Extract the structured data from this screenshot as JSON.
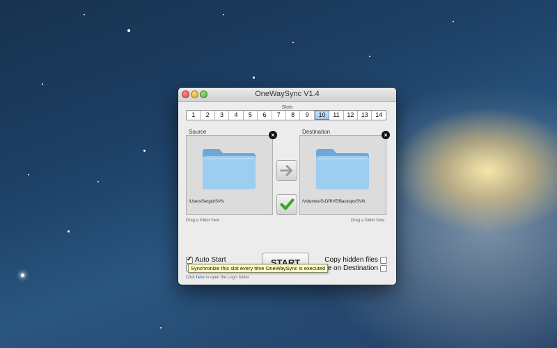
{
  "window": {
    "title": "OneWaySync V1.4"
  },
  "slots": {
    "label": "Slots",
    "items": [
      "1",
      "2",
      "3",
      "4",
      "5",
      "6",
      "7",
      "8",
      "9",
      "10",
      "11",
      "12",
      "13",
      "14"
    ],
    "active": "10"
  },
  "source": {
    "label": "Source",
    "path": "/Users/Sergio/SVN",
    "drag_hint": "Drag a folder here"
  },
  "destination": {
    "label": "Destination",
    "path": "/Volumes/G-DRIVE/Backups/SVN",
    "drag_hint": "Drag a folder here"
  },
  "options": {
    "auto_start": {
      "label": "Auto Start",
      "checked": true
    },
    "copy_hidden": {
      "label": "Copy hidden files",
      "checked": false
    },
    "delete_dest": {
      "label": "elete on Destination",
      "checked": false
    }
  },
  "start_label": "START",
  "log": {
    "prefix": "Click ",
    "link": "here",
    "suffix": " to open the Log's folder"
  },
  "tooltip": "Synchronize this slot every time OneWaySync is executed",
  "icons": {
    "remove": "close-circle-icon",
    "arrow": "arrow-right-icon",
    "check": "checkmark-icon",
    "folder": "folder-icon"
  },
  "colors": {
    "check": "#3aa826",
    "folder": "#8cc4ec",
    "link": "#2452c9"
  }
}
